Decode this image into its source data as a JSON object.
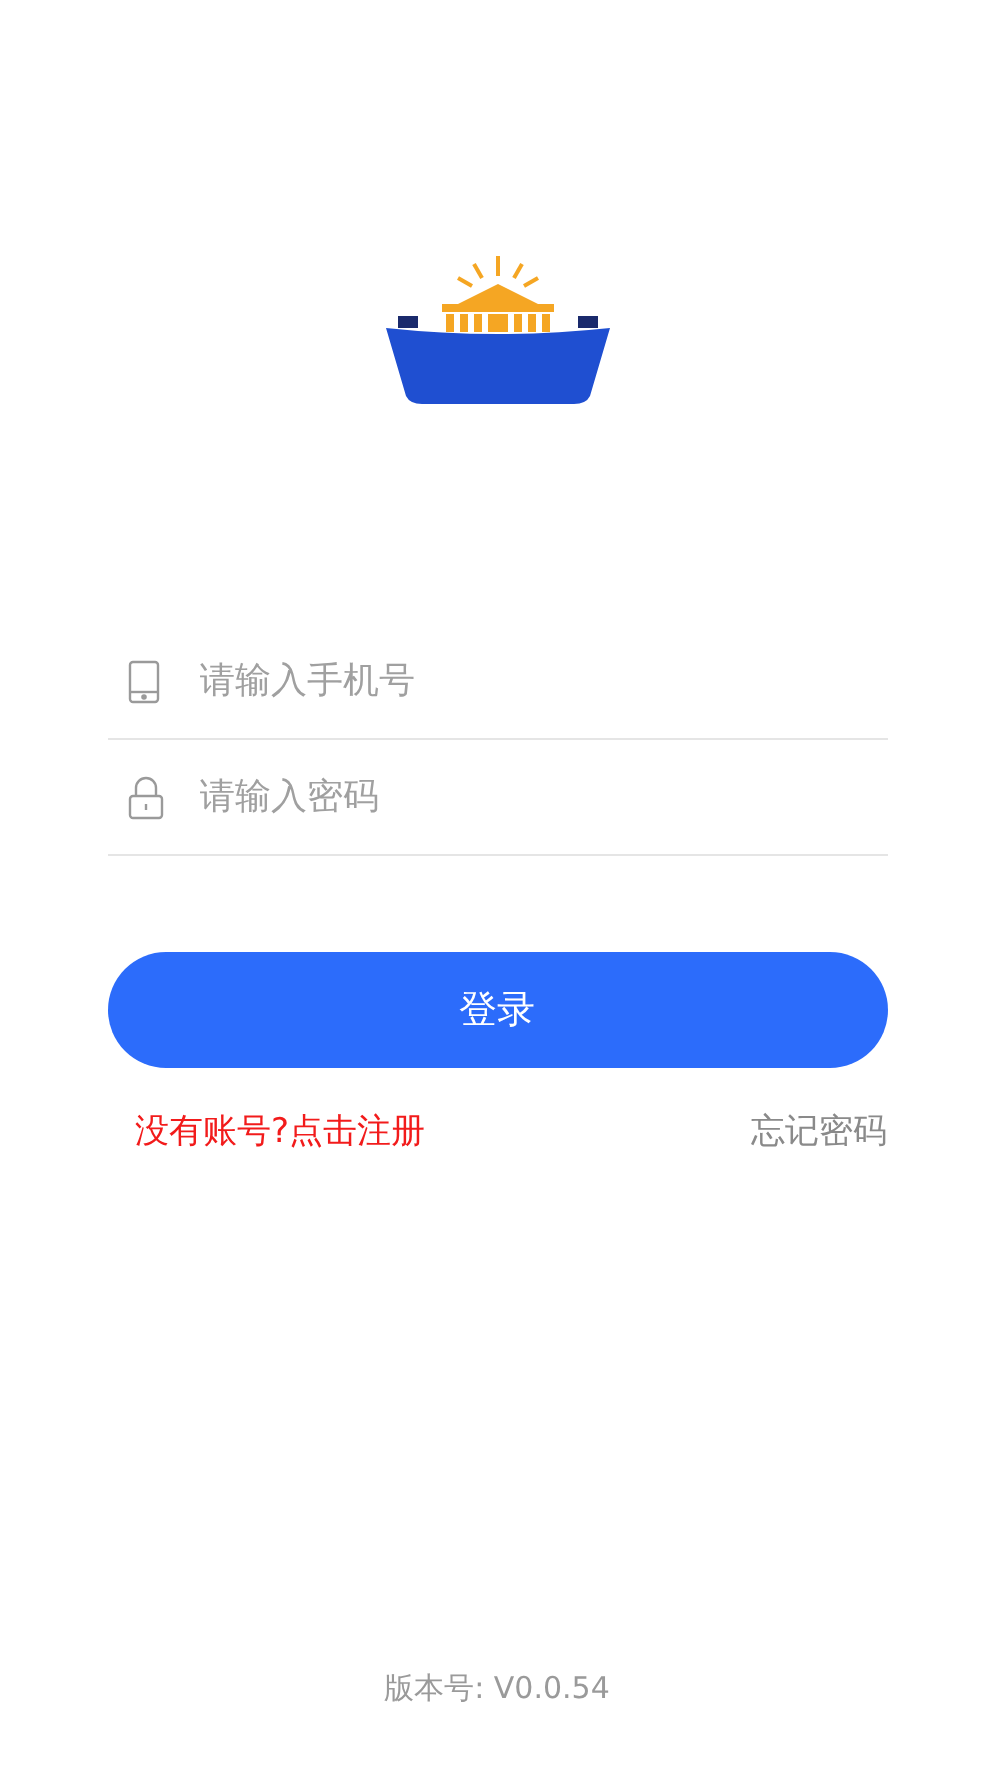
{
  "fields": [
    {
      "kind": "phone",
      "placeholder": "请输入手机号"
    },
    {
      "kind": "password",
      "placeholder": "请输入密码"
    }
  ],
  "login_button": "登录",
  "register_link": "没有账号?点击注册",
  "forgot_link": "忘记密码",
  "version": "版本号: V0.0.54"
}
